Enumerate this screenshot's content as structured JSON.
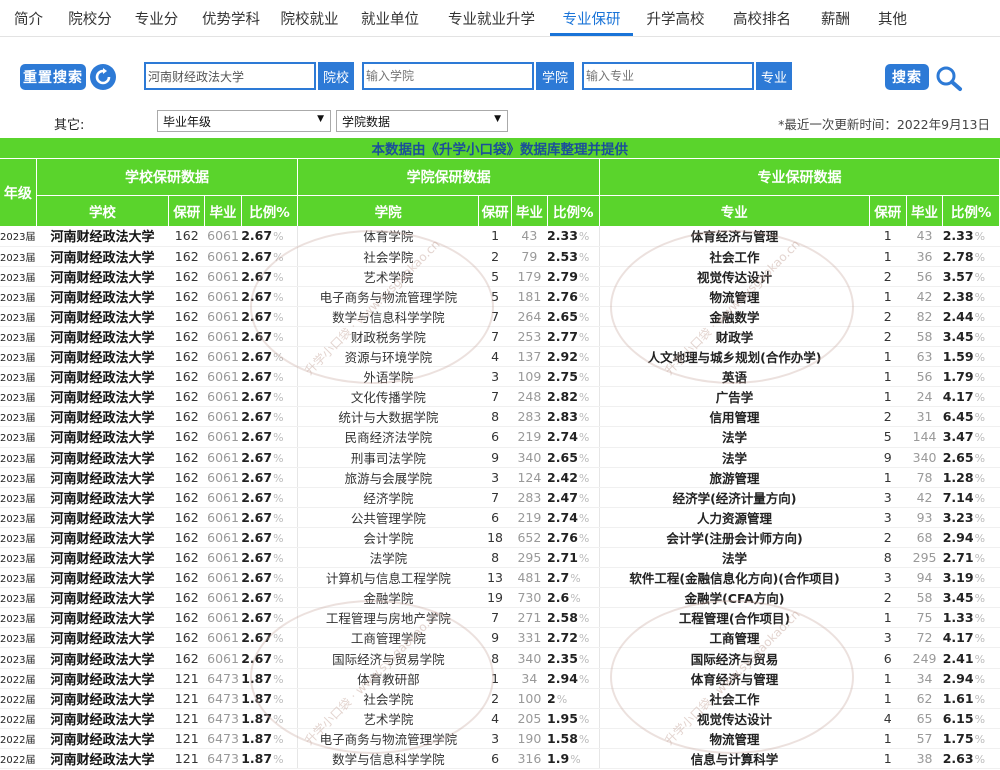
{
  "nav": {
    "tabs": [
      "简介",
      "院校分",
      "专业分",
      "优势学科",
      "院校就业",
      "就业单位",
      "专业就业升学",
      "专业保研",
      "升学高校",
      "高校排名",
      "薪酬",
      "其他"
    ],
    "active": "专业保研"
  },
  "search": {
    "reset_label": "重置搜索",
    "school_value": "河南财经政法大学",
    "school_btn": "院校",
    "college_placeholder": "输入学院",
    "college_btn": "学院",
    "major_placeholder": "输入专业",
    "major_btn": "专业",
    "search_label": "搜索"
  },
  "filter": {
    "other_label": "其它:",
    "year_select": "毕业年级",
    "college_select": "学院数据",
    "updated": "*最近一次更新时间：2022年9月13日"
  },
  "table": {
    "banner": "本数据由《升学小口袋》数据库整理并提供",
    "year_header": "年级",
    "group_school": "学校保研数据",
    "group_college": "学院保研数据",
    "group_major": "专业保研数据",
    "cols": {
      "school": "学校",
      "baoyan": "保研",
      "biye": "毕业",
      "bili": "比例%",
      "college": "学院",
      "major": "专业"
    },
    "watermark": "升学小口袋 · www.sysgaokao.cn",
    "rows": [
      [
        "2023届",
        "河南财经政法大学",
        "162",
        "6061",
        "2.67",
        "体育学院",
        "1",
        "43",
        "2.33",
        "体育经济与管理",
        "1",
        "43",
        "2.33"
      ],
      [
        "2023届",
        "河南财经政法大学",
        "162",
        "6061",
        "2.67",
        "社会学院",
        "2",
        "79",
        "2.53",
        "社会工作",
        "1",
        "36",
        "2.78"
      ],
      [
        "2023届",
        "河南财经政法大学",
        "162",
        "6061",
        "2.67",
        "艺术学院",
        "5",
        "179",
        "2.79",
        "视觉传达设计",
        "2",
        "56",
        "3.57"
      ],
      [
        "2023届",
        "河南财经政法大学",
        "162",
        "6061",
        "2.67",
        "电子商务与物流管理学院",
        "5",
        "181",
        "2.76",
        "物流管理",
        "1",
        "42",
        "2.38"
      ],
      [
        "2023届",
        "河南财经政法大学",
        "162",
        "6061",
        "2.67",
        "数学与信息科学学院",
        "7",
        "264",
        "2.65",
        "金融数学",
        "2",
        "82",
        "2.44"
      ],
      [
        "2023届",
        "河南财经政法大学",
        "162",
        "6061",
        "2.67",
        "财政税务学院",
        "7",
        "253",
        "2.77",
        "财政学",
        "2",
        "58",
        "3.45"
      ],
      [
        "2023届",
        "河南财经政法大学",
        "162",
        "6061",
        "2.67",
        "资源与环境学院",
        "4",
        "137",
        "2.92",
        "人文地理与城乡规划(合作办学)",
        "1",
        "63",
        "1.59"
      ],
      [
        "2023届",
        "河南财经政法大学",
        "162",
        "6061",
        "2.67",
        "外语学院",
        "3",
        "109",
        "2.75",
        "英语",
        "1",
        "56",
        "1.79"
      ],
      [
        "2023届",
        "河南财经政法大学",
        "162",
        "6061",
        "2.67",
        "文化传播学院",
        "7",
        "248",
        "2.82",
        "广告学",
        "1",
        "24",
        "4.17"
      ],
      [
        "2023届",
        "河南财经政法大学",
        "162",
        "6061",
        "2.67",
        "统计与大数据学院",
        "8",
        "283",
        "2.83",
        "信用管理",
        "2",
        "31",
        "6.45"
      ],
      [
        "2023届",
        "河南财经政法大学",
        "162",
        "6061",
        "2.67",
        "民商经济法学院",
        "6",
        "219",
        "2.74",
        "法学",
        "5",
        "144",
        "3.47"
      ],
      [
        "2023届",
        "河南财经政法大学",
        "162",
        "6061",
        "2.67",
        "刑事司法学院",
        "9",
        "340",
        "2.65",
        "法学",
        "9",
        "340",
        "2.65"
      ],
      [
        "2023届",
        "河南财经政法大学",
        "162",
        "6061",
        "2.67",
        "旅游与会展学院",
        "3",
        "124",
        "2.42",
        "旅游管理",
        "1",
        "78",
        "1.28"
      ],
      [
        "2023届",
        "河南财经政法大学",
        "162",
        "6061",
        "2.67",
        "经济学院",
        "7",
        "283",
        "2.47",
        "经济学(经济计量方向)",
        "3",
        "42",
        "7.14"
      ],
      [
        "2023届",
        "河南财经政法大学",
        "162",
        "6061",
        "2.67",
        "公共管理学院",
        "6",
        "219",
        "2.74",
        "人力资源管理",
        "3",
        "93",
        "3.23"
      ],
      [
        "2023届",
        "河南财经政法大学",
        "162",
        "6061",
        "2.67",
        "会计学院",
        "18",
        "652",
        "2.76",
        "会计学(注册会计师方向)",
        "2",
        "68",
        "2.94"
      ],
      [
        "2023届",
        "河南财经政法大学",
        "162",
        "6061",
        "2.67",
        "法学院",
        "8",
        "295",
        "2.71",
        "法学",
        "8",
        "295",
        "2.71"
      ],
      [
        "2023届",
        "河南财经政法大学",
        "162",
        "6061",
        "2.67",
        "计算机与信息工程学院",
        "13",
        "481",
        "2.7",
        "软件工程(金融信息化方向)(合作项目)",
        "3",
        "94",
        "3.19"
      ],
      [
        "2023届",
        "河南财经政法大学",
        "162",
        "6061",
        "2.67",
        "金融学院",
        "19",
        "730",
        "2.6",
        "金融学(CFA方向)",
        "2",
        "58",
        "3.45"
      ],
      [
        "2023届",
        "河南财经政法大学",
        "162",
        "6061",
        "2.67",
        "工程管理与房地产学院",
        "7",
        "271",
        "2.58",
        "工程管理(合作项目)",
        "1",
        "75",
        "1.33"
      ],
      [
        "2023届",
        "河南财经政法大学",
        "162",
        "6061",
        "2.67",
        "工商管理学院",
        "9",
        "331",
        "2.72",
        "工商管理",
        "3",
        "72",
        "4.17"
      ],
      [
        "2023届",
        "河南财经政法大学",
        "162",
        "6061",
        "2.67",
        "国际经济与贸易学院",
        "8",
        "340",
        "2.35",
        "国际经济与贸易",
        "6",
        "249",
        "2.41"
      ],
      [
        "2022届",
        "河南财经政法大学",
        "121",
        "6473",
        "1.87",
        "体育教研部",
        "1",
        "34",
        "2.94",
        "体育经济与管理",
        "1",
        "34",
        "2.94"
      ],
      [
        "2022届",
        "河南财经政法大学",
        "121",
        "6473",
        "1.87",
        "社会学院",
        "2",
        "100",
        "2",
        "社会工作",
        "1",
        "62",
        "1.61"
      ],
      [
        "2022届",
        "河南财经政法大学",
        "121",
        "6473",
        "1.87",
        "艺术学院",
        "4",
        "205",
        "1.95",
        "视觉传达设计",
        "4",
        "65",
        "6.15"
      ],
      [
        "2022届",
        "河南财经政法大学",
        "121",
        "6473",
        "1.87",
        "电子商务与物流管理学院",
        "3",
        "190",
        "1.58",
        "物流管理",
        "1",
        "57",
        "1.75"
      ],
      [
        "2022届",
        "河南财经政法大学",
        "121",
        "6473",
        "1.87",
        "数学与信息科学学院",
        "6",
        "316",
        "1.9",
        "信息与计算科学",
        "1",
        "38",
        "2.63"
      ]
    ]
  }
}
